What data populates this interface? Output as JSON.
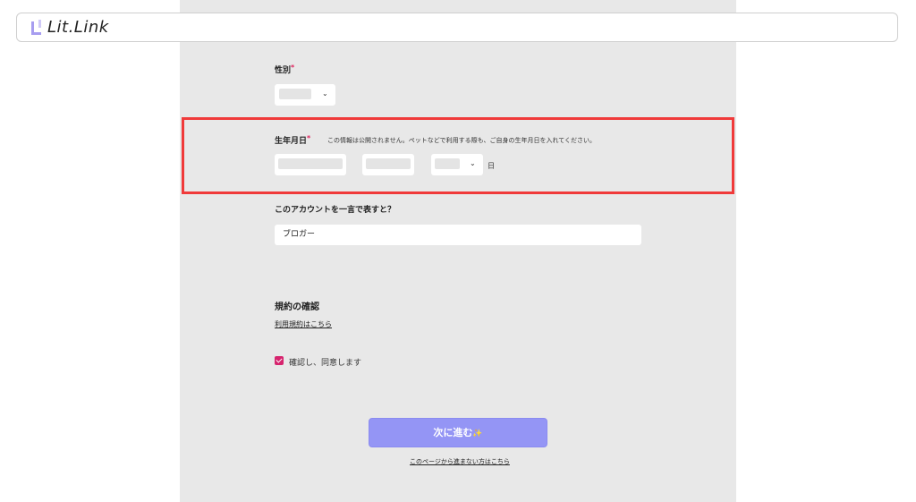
{
  "app": {
    "logo_text": "Lit.Link"
  },
  "form": {
    "gender": {
      "label": "性別",
      "required_mark": "*"
    },
    "birthday": {
      "label": "生年月日",
      "required_mark": "*",
      "note": "この情報は公開されません。ペットなどで利用する際も、ご自身の生年月日を入れてください。",
      "day_unit": "日"
    },
    "account_description": {
      "label": "このアカウントを一言で表すと？",
      "value": "ブロガー"
    },
    "terms": {
      "heading": "規約の確認",
      "link": "利用規約はこちら",
      "agree_label": "確認し、同意します",
      "agreed": true
    },
    "next_button": "次に進む",
    "next_button_icon": "sparkle-icon",
    "bottom_link": "このページから進まない方はこちら"
  },
  "colors": {
    "highlight_border": "#f03a3a",
    "button": "#9495f5",
    "checkbox": "#d6246e",
    "panel_bg": "#e8e8e8"
  }
}
